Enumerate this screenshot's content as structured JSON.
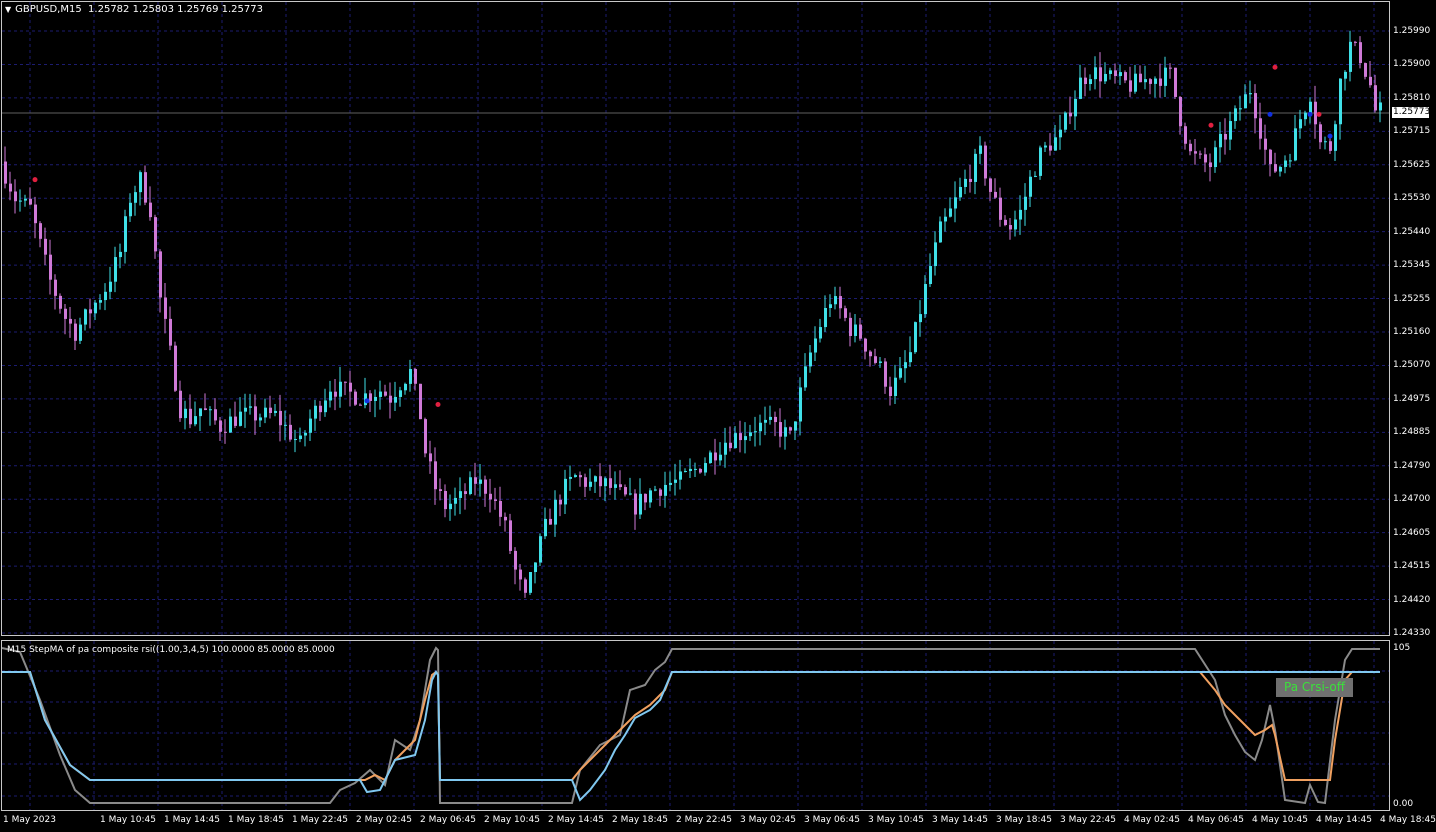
{
  "chart_header": {
    "symbol_info": "GBPUSD,M15  1.25782 1.25803 1.25769 1.25773",
    "menu_icon": "triangle-down-icon"
  },
  "indicator": {
    "label": "M15 StepMA of pa composite rsi((1.00,3,4,5) 100.0000 85.0000 85.0000",
    "button_label": "Pa Crsi-off",
    "scale_top": "105",
    "scale_bottom": "0.00"
  },
  "price_scale": [
    "1.25990",
    "1.25900",
    "1.25810",
    "1.25715",
    "1.25625",
    "1.25530",
    "1.25440",
    "1.25345",
    "1.25255",
    "1.25160",
    "1.25070",
    "1.24975",
    "1.24885",
    "1.24790",
    "1.24700",
    "1.24605",
    "1.24515",
    "1.24420",
    "1.24330"
  ],
  "current_price": "1.25773",
  "time_axis": [
    "1 May 2023",
    "1 May 10:45",
    "1 May 14:45",
    "1 May 18:45",
    "1 May 22:45",
    "2 May 02:45",
    "2 May 06:45",
    "2 May 10:45",
    "2 May 14:45",
    "2 May 18:45",
    "2 May 22:45",
    "3 May 02:45",
    "3 May 06:45",
    "3 May 10:45",
    "3 May 14:45",
    "3 May 18:45",
    "3 May 22:45",
    "4 May 02:45",
    "4 May 06:45",
    "4 May 10:45",
    "4 May 14:45",
    "4 May 18:45"
  ],
  "colors": {
    "background": "#000000",
    "bull_candle": "#40e0e8",
    "bear_candle": "#d07ad8",
    "grid": "#1c1c70",
    "rsi_line": "#8a8a8a",
    "step_ma_orange": "#f0a060",
    "step_ma_blue": "#80c8f0",
    "sell_marker": "#e02040",
    "buy_marker": "#1030e0"
  },
  "chart_data": {
    "type": "candlestick",
    "title": "GBPUSD,M15",
    "ylim": [
      1.2433,
      1.2603
    ],
    "price_path": [
      [
        0,
        1.2563
      ],
      [
        3,
        1.2553
      ],
      [
        6,
        1.255
      ],
      [
        8,
        1.254
      ],
      [
        10,
        1.253
      ],
      [
        13,
        1.252
      ],
      [
        15,
        1.2516
      ],
      [
        18,
        1.2522
      ],
      [
        21,
        1.2528
      ],
      [
        24,
        1.2538
      ],
      [
        26,
        1.2553
      ],
      [
        28,
        1.2558
      ],
      [
        30,
        1.255
      ],
      [
        32,
        1.2525
      ],
      [
        34,
        1.251
      ],
      [
        36,
        1.2495
      ],
      [
        38,
        1.2492
      ],
      [
        40,
        1.2495
      ],
      [
        44,
        1.249
      ],
      [
        48,
        1.2493
      ],
      [
        52,
        1.2493
      ],
      [
        55,
        1.2493
      ],
      [
        58,
        1.2488
      ],
      [
        60,
        1.2485
      ],
      [
        62,
        1.2492
      ],
      [
        66,
        1.2501
      ],
      [
        68,
        1.25
      ],
      [
        72,
        1.2498
      ],
      [
        76,
        1.25
      ],
      [
        78,
        1.2498
      ],
      [
        80,
        1.2502
      ],
      [
        82,
        1.2505
      ],
      [
        84,
        1.2493
      ],
      [
        85,
        1.2483
      ],
      [
        87,
        1.2473
      ],
      [
        89,
        1.2468
      ],
      [
        92,
        1.247
      ],
      [
        95,
        1.2475
      ],
      [
        98,
        1.2472
      ],
      [
        101,
        1.2462
      ],
      [
        103,
        1.245
      ],
      [
        105,
        1.2442
      ],
      [
        107,
        1.2453
      ],
      [
        109,
        1.2462
      ],
      [
        111,
        1.2468
      ],
      [
        113,
        1.2473
      ],
      [
        115,
        1.2476
      ],
      [
        118,
        1.2474
      ],
      [
        121,
        1.2474
      ],
      [
        124,
        1.2471
      ],
      [
        127,
        1.2468
      ],
      [
        130,
        1.2472
      ],
      [
        133,
        1.2474
      ],
      [
        136,
        1.2475
      ],
      [
        139,
        1.2478
      ],
      [
        142,
        1.2482
      ],
      [
        145,
        1.2486
      ],
      [
        148,
        1.2488
      ],
      [
        151,
        1.249
      ],
      [
        155,
        1.249
      ],
      [
        158,
        1.2487
      ],
      [
        160,
        1.2499
      ],
      [
        162,
        1.251
      ],
      [
        164,
        1.2518
      ],
      [
        166,
        1.2525
      ],
      [
        168,
        1.2522
      ],
      [
        170,
        1.2517
      ],
      [
        172,
        1.2515
      ],
      [
        174,
        1.251
      ],
      [
        176,
        1.2506
      ],
      [
        178,
        1.25
      ],
      [
        180,
        1.2504
      ],
      [
        182,
        1.251
      ],
      [
        184,
        1.2522
      ],
      [
        186,
        1.2534
      ],
      [
        188,
        1.2544
      ],
      [
        190,
        1.2549
      ],
      [
        192,
        1.2555
      ],
      [
        194,
        1.256
      ],
      [
        196,
        1.2565
      ],
      [
        198,
        1.2555
      ],
      [
        200,
        1.2548
      ],
      [
        202,
        1.2545
      ],
      [
        204,
        1.2549
      ],
      [
        206,
        1.2558
      ],
      [
        208,
        1.2565
      ],
      [
        210,
        1.2568
      ],
      [
        212,
        1.257
      ],
      [
        214,
        1.2578
      ],
      [
        216,
        1.2585
      ],
      [
        218,
        1.2588
      ],
      [
        222,
        1.2586
      ],
      [
        226,
        1.2584
      ],
      [
        230,
        1.2586
      ],
      [
        234,
        1.2587
      ],
      [
        236,
        1.2575
      ],
      [
        238,
        1.2565
      ],
      [
        240,
        1.2563
      ],
      [
        242,
        1.2562
      ],
      [
        244,
        1.2568
      ],
      [
        246,
        1.2573
      ],
      [
        248,
        1.2578
      ],
      [
        250,
        1.2583
      ],
      [
        252,
        1.2572
      ],
      [
        254,
        1.256
      ],
      [
        256,
        1.2562
      ],
      [
        258,
        1.2566
      ],
      [
        260,
        1.2575
      ],
      [
        262,
        1.2582
      ],
      [
        264,
        1.2568
      ],
      [
        266,
        1.2567
      ],
      [
        268,
        1.2585
      ],
      [
        270,
        1.2595
      ],
      [
        272,
        1.2592
      ],
      [
        274,
        1.2584
      ],
      [
        275,
        1.2577
      ]
    ]
  }
}
